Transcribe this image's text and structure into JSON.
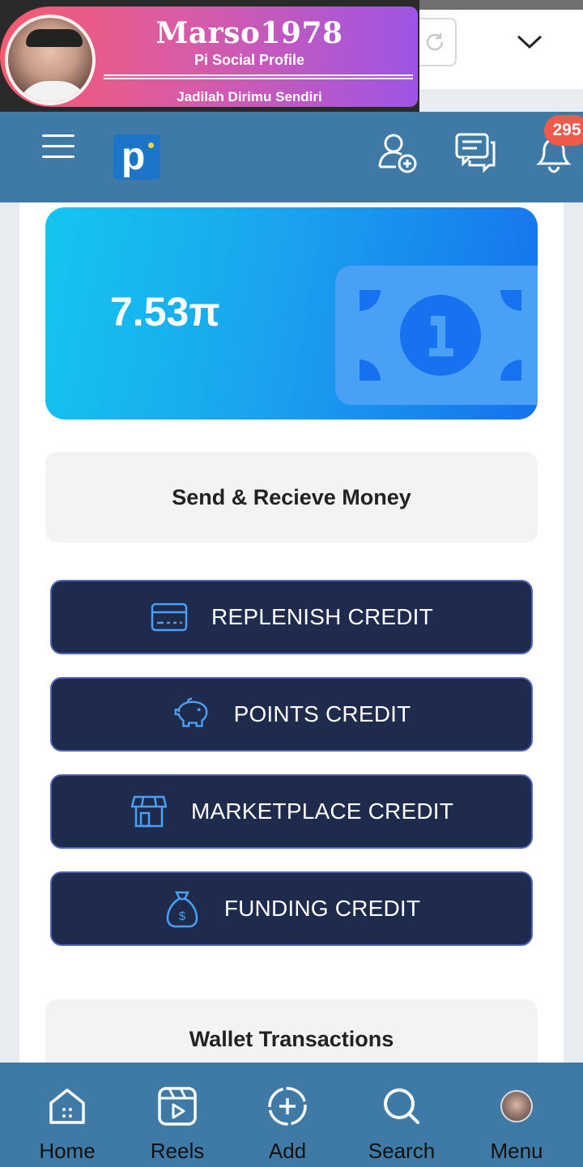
{
  "profile_overlay": {
    "username": "Marso1978",
    "subtitle": "Pi Social Profile",
    "tagline": "Jadilah Dirimu Sendiri"
  },
  "header": {
    "notification_count": "295"
  },
  "wallet": {
    "balance": "7.53π"
  },
  "send_box": {
    "label": "Send & Recieve Money"
  },
  "credit_buttons": [
    {
      "label": "REPLENISH CREDIT",
      "icon": "credit-card-icon"
    },
    {
      "label": "POINTS CREDIT",
      "icon": "piggy-bank-icon"
    },
    {
      "label": "MARKETPLACE CREDIT",
      "icon": "store-icon"
    },
    {
      "label": "FUNDING CREDIT",
      "icon": "money-bag-icon"
    }
  ],
  "transactions": {
    "title": "Wallet Transactions"
  },
  "bottom_nav": [
    {
      "label": "Home",
      "icon": "home-icon"
    },
    {
      "label": "Reels",
      "icon": "reels-icon"
    },
    {
      "label": "Add",
      "icon": "add-icon"
    },
    {
      "label": "Search",
      "icon": "search-icon"
    },
    {
      "label": "Menu",
      "icon": "avatar-menu-icon"
    }
  ],
  "colors": {
    "header_bg": "#3e7aa5",
    "credit_button_bg": "#1e2b4c",
    "badge": "#f15a4a"
  }
}
